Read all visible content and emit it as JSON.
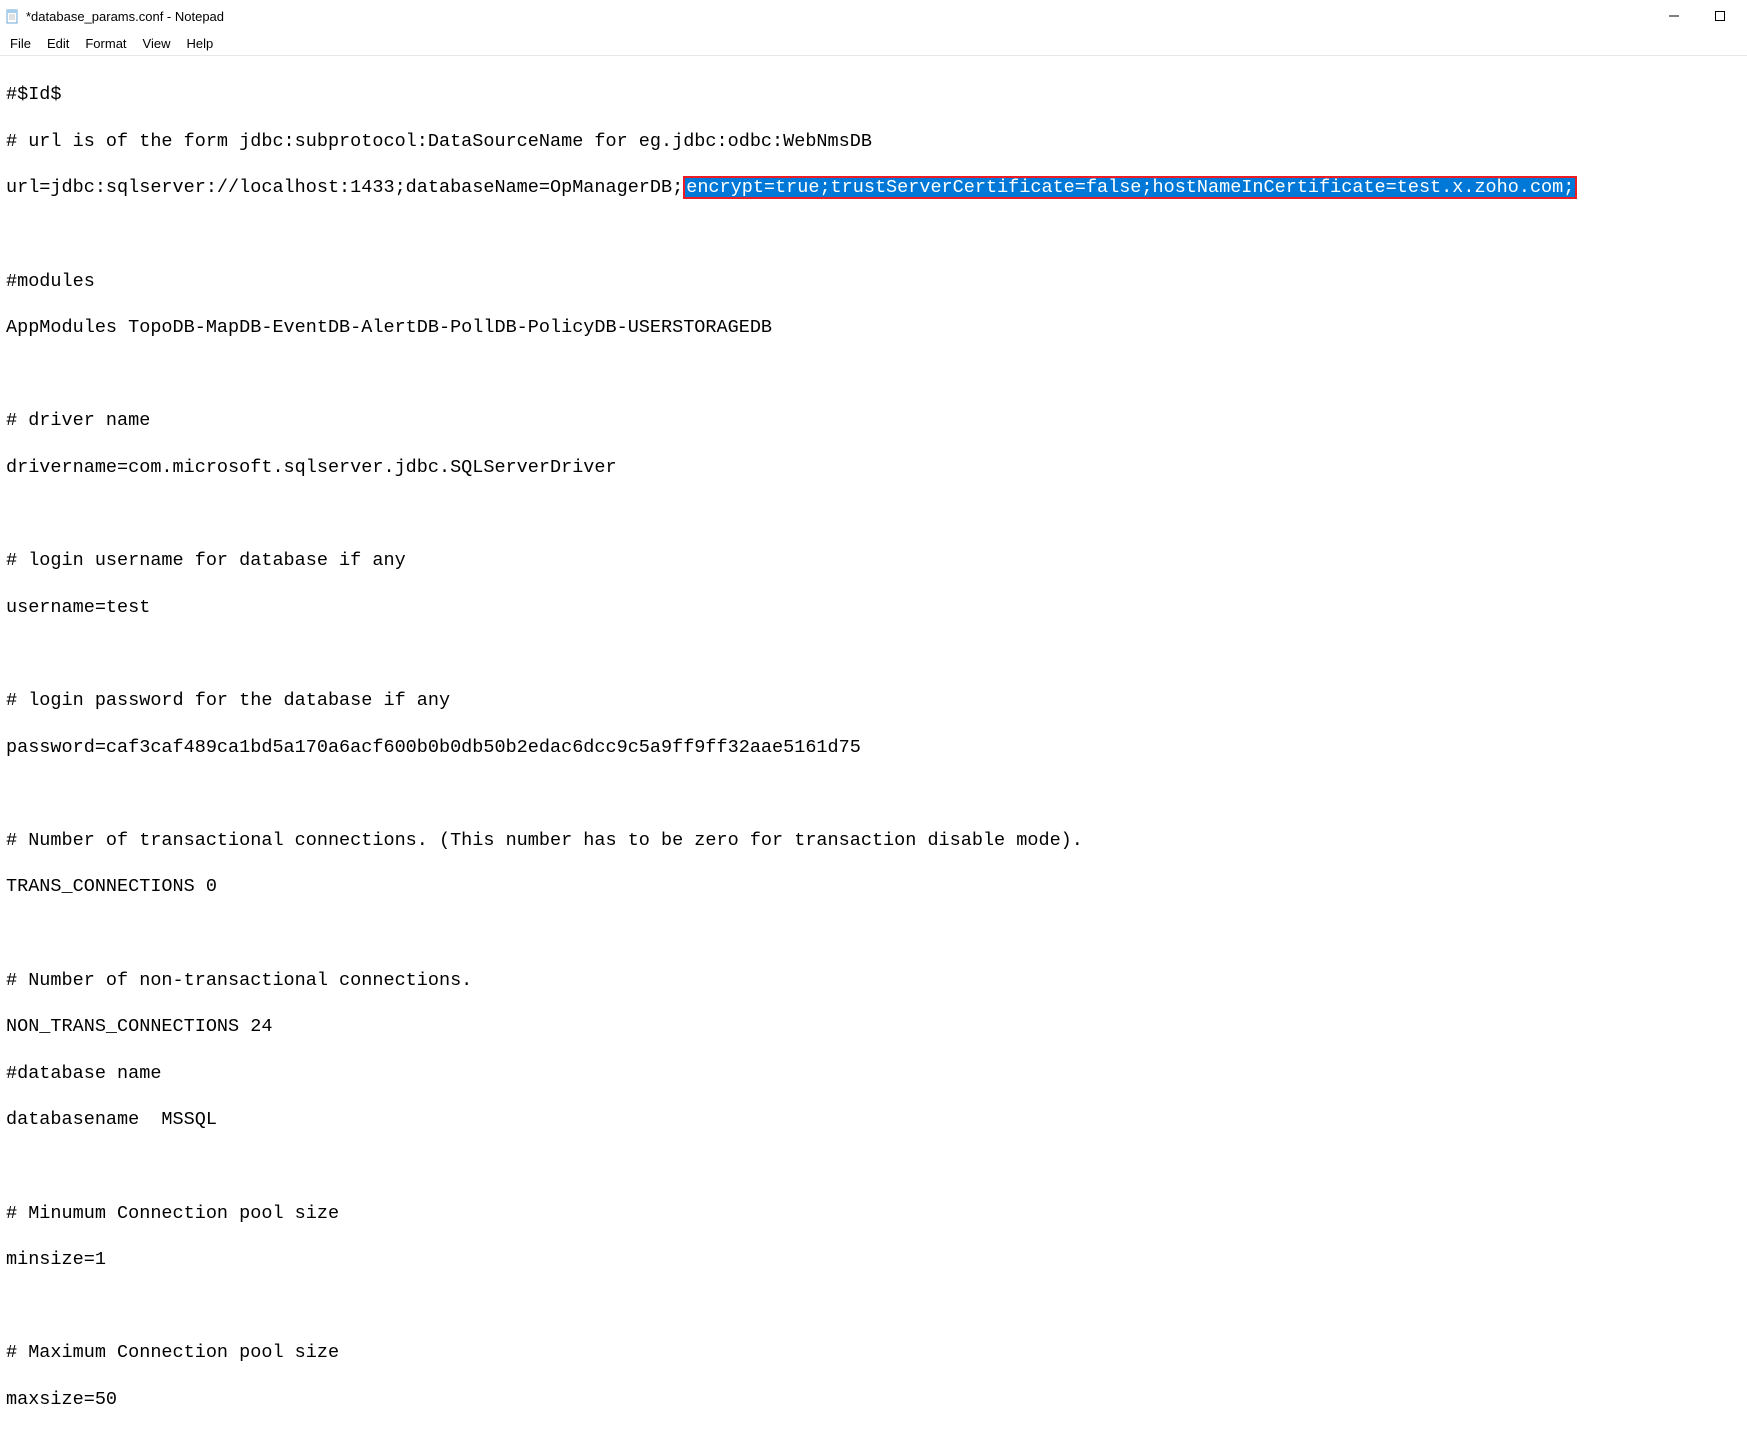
{
  "window": {
    "title": "*database_params.conf - Notepad"
  },
  "menu": {
    "file": "File",
    "edit": "Edit",
    "format": "Format",
    "view": "View",
    "help": "Help"
  },
  "content": {
    "lines": [
      "#$Id$",
      "# url is of the form jdbc:subprotocol:DataSourceName for eg.jdbc:odbc:WebNmsDB"
    ],
    "url_line_prefix": "url=jdbc:sqlserver://localhost:1433;databaseName=OpManagerDB;",
    "url_line_highlight": "encrypt=true;trustServerCertificate=false;hostNameInCertificate=test.x.zoho.com;",
    "after_lines": [
      "",
      "#modules",
      "AppModules TopoDB-MapDB-EventDB-AlertDB-PollDB-PolicyDB-USERSTORAGEDB",
      "",
      "# driver name",
      "drivername=com.microsoft.sqlserver.jdbc.SQLServerDriver",
      "",
      "# login username for database if any",
      "username=test",
      "",
      "# login password for the database if any",
      "password=caf3caf489ca1bd5a170a6acf600b0b0db50b2edac6dcc9c5a9ff9ff32aae5161d75",
      "",
      "# Number of transactional connections. (This number has to be zero for transaction disable mode).",
      "TRANS_CONNECTIONS 0",
      "",
      "# Number of non-transactional connections.",
      "NON_TRANS_CONNECTIONS 24",
      "#database name",
      "databasename  MSSQL",
      "",
      "# Minumum Connection pool size",
      "minsize=1",
      "",
      "# Maximum Connection pool size",
      "maxsize=50"
    ]
  }
}
